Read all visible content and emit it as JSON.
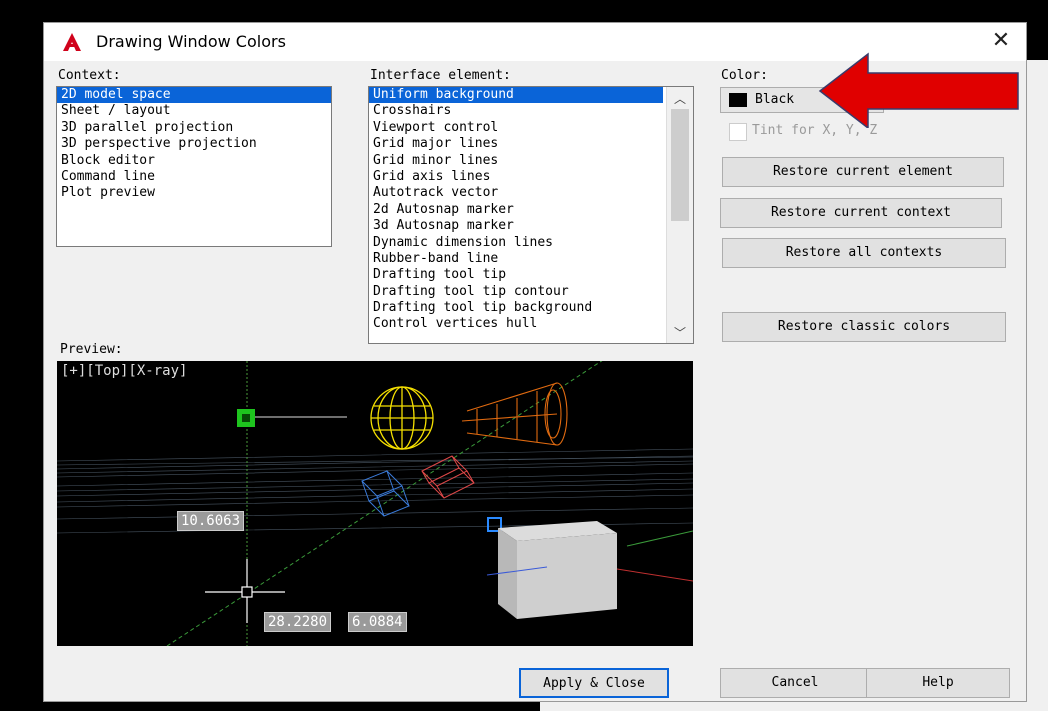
{
  "title": "Drawing Window Colors",
  "context": {
    "label": "Context:",
    "items": [
      "2D model space",
      "Sheet / layout",
      "3D parallel projection",
      "3D perspective projection",
      "Block editor",
      "Command line",
      "Plot preview"
    ],
    "selected_index": 0
  },
  "interface_element": {
    "label": "Interface element:",
    "items": [
      "Uniform background",
      "Crosshairs",
      "Viewport control",
      "Grid major lines",
      "Grid minor lines",
      "Grid axis lines",
      "Autotrack vector",
      "2d Autosnap marker",
      "3d Autosnap marker",
      "Dynamic dimension lines",
      "Rubber-band line",
      "Drafting tool tip",
      "Drafting tool tip contour",
      "Drafting tool tip background",
      "Control vertices hull"
    ],
    "selected_index": 0
  },
  "color": {
    "label": "Color:",
    "value": "Black",
    "swatch": "#000000",
    "tint_label": "Tint for X, Y, Z",
    "tint_checked": false
  },
  "buttons": {
    "restore_current_element": "Restore current element",
    "restore_current_context": "Restore current context",
    "restore_all_contexts": "Restore all contexts",
    "restore_classic_colors": "Restore classic colors",
    "apply_close": "Apply & Close",
    "cancel": "Cancel",
    "help": "Help"
  },
  "preview": {
    "label": "Preview:",
    "viewport_control": "[+][Top][X-ray]",
    "tip1": "10.6063",
    "tip2": "28.2280",
    "tip3": "6.0884"
  },
  "colors": {
    "selection": "#0a64d8",
    "annotation_arrow": "#e00000"
  }
}
